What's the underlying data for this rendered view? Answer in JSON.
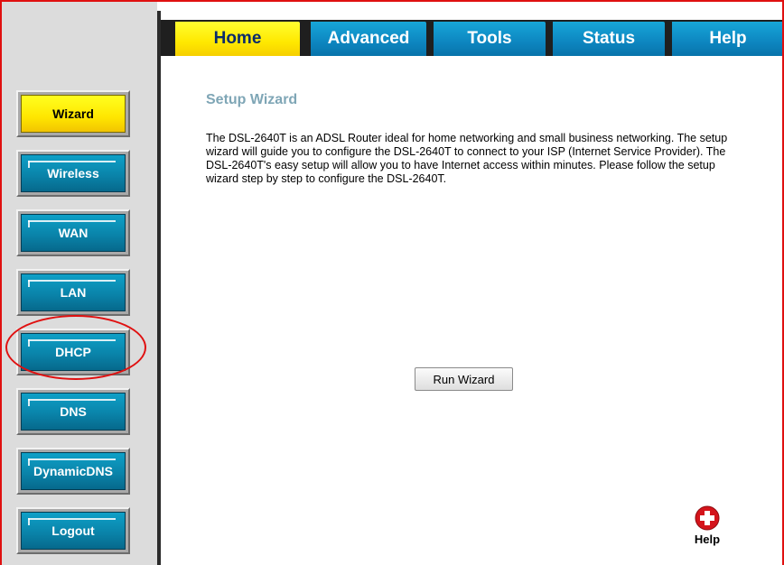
{
  "tabs": [
    {
      "label": "Home",
      "active": true
    },
    {
      "label": "Advanced",
      "active": false
    },
    {
      "label": "Tools",
      "active": false
    },
    {
      "label": "Status",
      "active": false
    },
    {
      "label": "Help",
      "active": false
    }
  ],
  "sidebar": {
    "items": [
      {
        "label": "Wizard",
        "active": true
      },
      {
        "label": "Wireless",
        "active": false
      },
      {
        "label": "WAN",
        "active": false
      },
      {
        "label": "LAN",
        "active": false
      },
      {
        "label": "DHCP",
        "active": false,
        "highlighted": true
      },
      {
        "label": "DNS",
        "active": false
      },
      {
        "label": "DynamicDNS",
        "active": false
      },
      {
        "label": "Logout",
        "active": false
      }
    ]
  },
  "main": {
    "title": "Setup Wizard",
    "description": "The DSL-2640T is an ADSL Router ideal for home networking and small business networking. The setup wizard will guide you to configure the DSL-2640T to connect to your ISP (Internet Service Provider). The DSL-2640T's easy setup will allow you to have Internet access within minutes. Please follow the setup wizard step by step to configure the DSL-2640T.",
    "run_button_label": "Run Wizard",
    "help_label": "Help"
  },
  "colors": {
    "tab_active": "#ffe800",
    "tab_inactive": "#0d86c0",
    "button_active": "#ffe600",
    "button_inactive": "#0a84aa",
    "heading": "#7fa6b6",
    "annotation": "#e01010"
  },
  "icons": {
    "help": "plus-circle-icon"
  }
}
